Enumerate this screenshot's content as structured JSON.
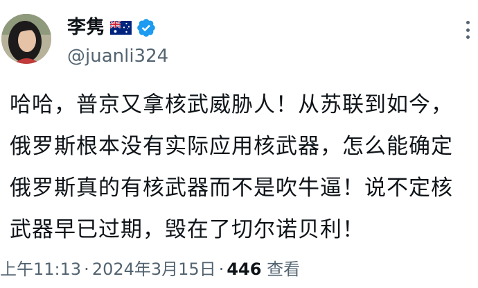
{
  "author": {
    "display_name": "李隽",
    "handle": "@juanli324",
    "flag_icon": "australia-flag-icon",
    "verified_icon": "verified-badge-icon",
    "verified_color": "#1d9bf0"
  },
  "tweet": {
    "lines": [
      "哈哈，普京又拿核武威胁人！从苏联到如今，",
      "俄罗斯根本没有实际应用核武器，怎么能确定",
      "俄罗斯真的有核武器而不是吹牛逼！说不定核",
      "武器早已过期，毁在了切尔诺贝利！"
    ]
  },
  "meta": {
    "time": "上午11:13",
    "separator": "·",
    "date": "2024年3月15日",
    "views_count": "446",
    "views_label": "查看"
  },
  "more_icon": "more-options-icon"
}
